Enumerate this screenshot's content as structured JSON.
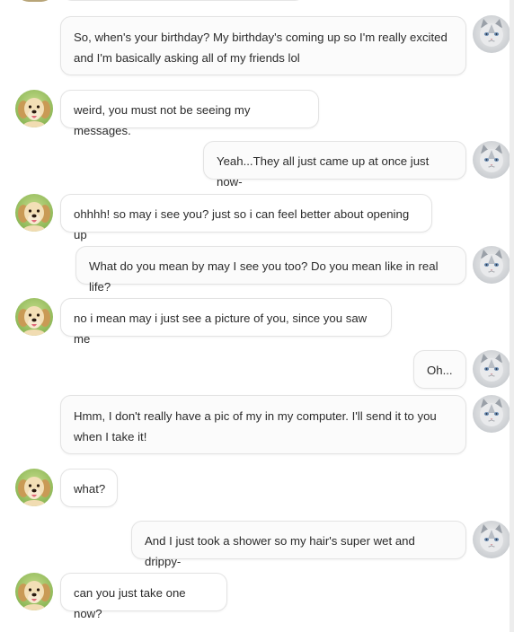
{
  "messages": [
    {
      "from": "cat",
      "text": "So, when's your birthday? My birthday's coming up so I'm really excited and I'm basically asking all of my friends lol"
    },
    {
      "from": "dog",
      "text": "weird, you must not be seeing my messages."
    },
    {
      "from": "cat",
      "text": "Yeah...They all just came up at once just now-"
    },
    {
      "from": "dog",
      "text": "ohhhh! so may i see you? just so i can feel better about opening up"
    },
    {
      "from": "cat",
      "text": "What do you mean by may I see you too? Do you mean like in real life?"
    },
    {
      "from": "dog",
      "text": "no i mean may i just see a picture of you, since you saw me"
    },
    {
      "from": "cat",
      "text": "Oh..."
    },
    {
      "from": "cat",
      "text": "Hmm, I don't really have a pic of my in my computer. I'll send it to you when I take it!"
    },
    {
      "from": "dog",
      "text": "what?"
    },
    {
      "from": "cat",
      "text": "And I just took a shower so my hair's super wet and drippy-"
    },
    {
      "from": "dog",
      "text": "can you just take one now?"
    }
  ],
  "avatars": {
    "dog": {
      "icon": "puppy-avatar-icon",
      "bg": "#9cc46a"
    },
    "cat": {
      "icon": "cat-avatar-icon",
      "bg": "#d9dce0"
    }
  }
}
